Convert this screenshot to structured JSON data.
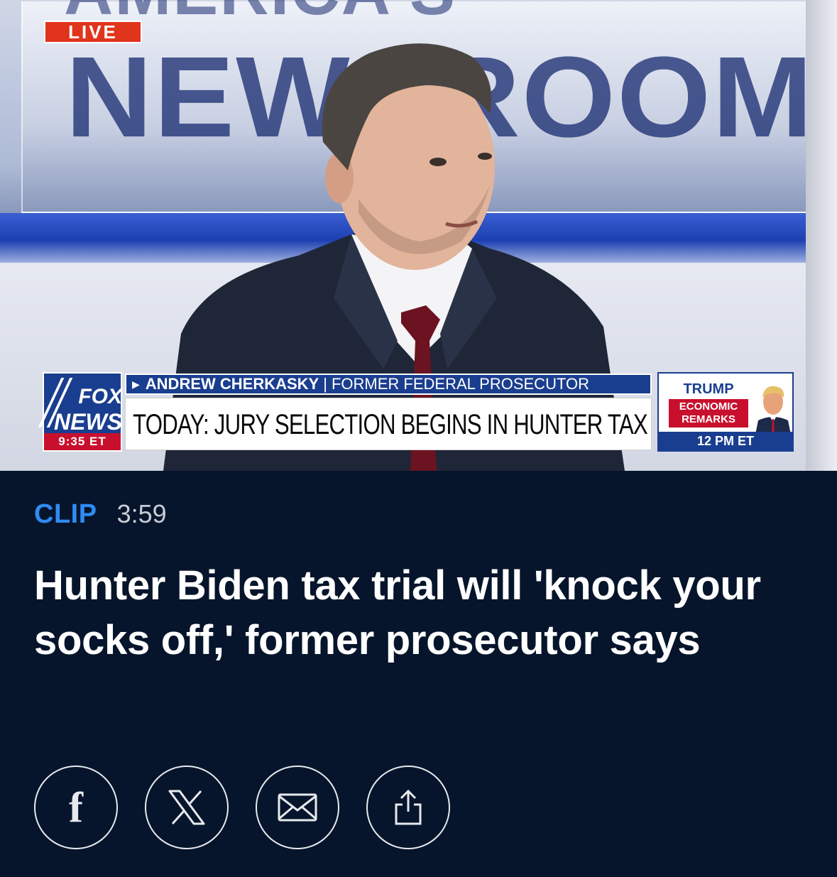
{
  "video": {
    "background_text_top": "AMERICA'S",
    "background_text_main": "NEWSROOM",
    "live_badge": "LIVE",
    "lower_third": {
      "network_logo_top": "FOX",
      "network_logo_bottom": "NEWS",
      "time": "9:35 ET",
      "guest_name": "ANDREW CHERKASKY",
      "guest_title": "FORMER FEDERAL PROSECUTOR",
      "headline": "TODAY: JURY SELECTION BEGINS IN HUNTER TAX TRIAL",
      "promo": {
        "name": "TRUMP",
        "line1": "ECONOMIC",
        "line2": "REMARKS",
        "time": "12 PM ET"
      }
    }
  },
  "article": {
    "type_label": "CLIP",
    "duration": "3:59",
    "headline": "Hunter Biden tax trial will 'knock your socks off,' former prosecutor says"
  },
  "share": {
    "buttons": [
      {
        "icon": "facebook-icon",
        "glyph": "f"
      },
      {
        "icon": "x-icon"
      },
      {
        "icon": "mail-icon"
      },
      {
        "icon": "share-icon"
      }
    ]
  },
  "colors": {
    "background": "#06152b",
    "accent": "#2f8bf5",
    "fox_blue": "#1a3e8f",
    "fox_red": "#c8102e",
    "live_red": "#e0341d"
  }
}
